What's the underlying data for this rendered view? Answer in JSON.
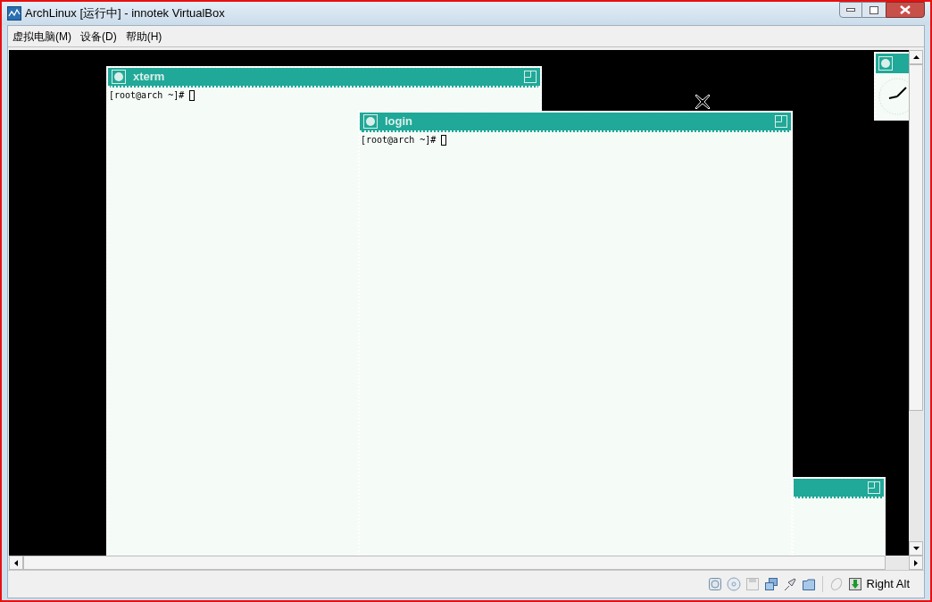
{
  "window": {
    "title": "ArchLinux [运行中] - innotek VirtualBox"
  },
  "menu": [
    "虚拟电脑(M)",
    "设备(D)",
    "帮助(H)"
  ],
  "desktop": {
    "windows": [
      {
        "kind": "terminal",
        "title": "xterm",
        "lines": [
          "[root@arch ~]# "
        ]
      },
      {
        "kind": "terminal",
        "title": "login",
        "lines": [
          "[root@arch ~]# "
        ]
      },
      {
        "kind": "blank"
      },
      {
        "kind": "clock"
      }
    ]
  },
  "status_bar": {
    "host_key": "Right Alt"
  }
}
